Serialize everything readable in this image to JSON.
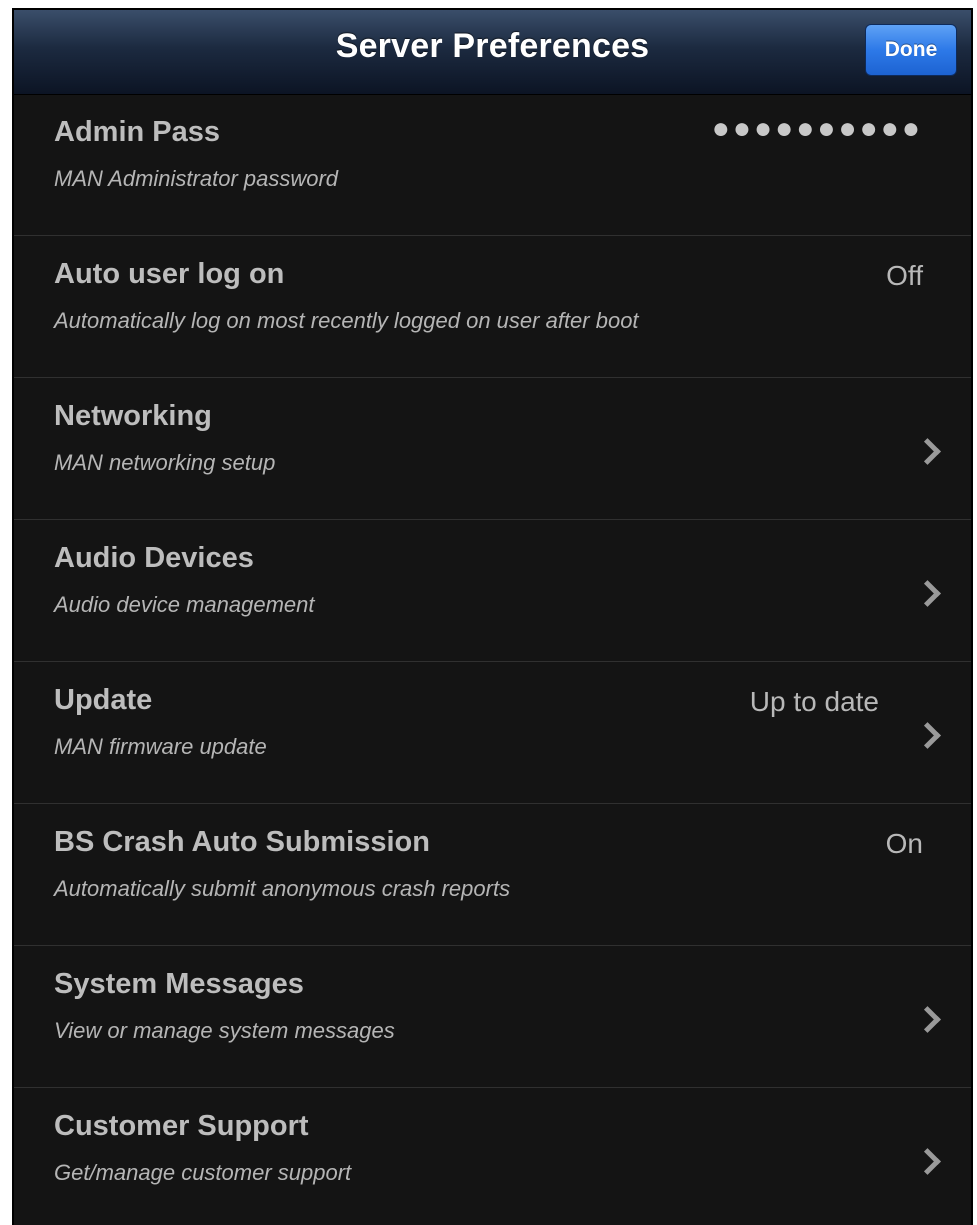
{
  "header": {
    "title": "Server Preferences",
    "done_label": "Done"
  },
  "rows": [
    {
      "title": "Admin Pass",
      "subtitle": "MAN Administrator password",
      "value": "●●●●●●●●●●",
      "chevron": false
    },
    {
      "title": "Auto user log on",
      "subtitle": "Automatically log on most recently logged on user after boot",
      "value": "Off",
      "chevron": false
    },
    {
      "title": "Networking",
      "subtitle": "MAN networking setup",
      "value": "",
      "chevron": true
    },
    {
      "title": "Audio Devices",
      "subtitle": "Audio device management",
      "value": "",
      "chevron": true
    },
    {
      "title": "Update",
      "subtitle": "MAN firmware update",
      "value": "Up to date",
      "chevron": true
    },
    {
      "title": "BS Crash Auto Submission",
      "subtitle": "Automatically submit anonymous crash reports",
      "value": "On",
      "chevron": false
    },
    {
      "title": "System Messages",
      "subtitle": "View or manage system messages",
      "value": "",
      "chevron": true
    },
    {
      "title": "Customer Support",
      "subtitle": "Get/manage customer support",
      "value": "",
      "chevron": true
    }
  ],
  "icons": {
    "disclosure": "chevron-right-icon"
  },
  "colors": {
    "done_button": "#2d79e8",
    "background": "#141414",
    "navbar": "#1c2a40"
  }
}
